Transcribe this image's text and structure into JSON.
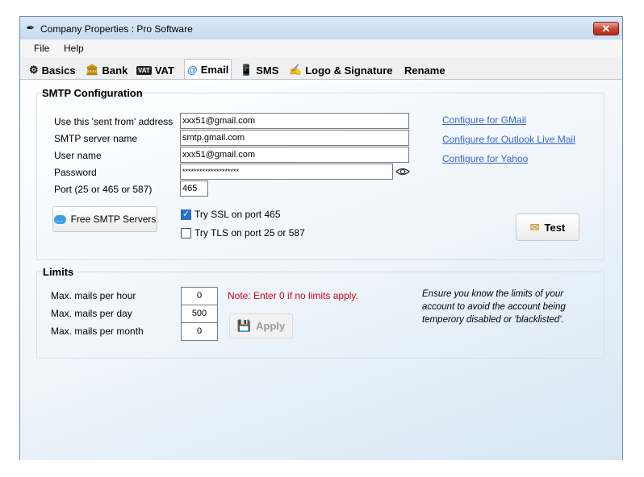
{
  "window": {
    "title": "Company Properties : Pro Software",
    "close_label": "✕"
  },
  "menu": [
    "File",
    "Help"
  ],
  "tabs": [
    {
      "label": "Basics",
      "icon": "gear-icon",
      "glyph": "⚙"
    },
    {
      "label": "Bank",
      "icon": "bank-icon",
      "glyph": "🏛"
    },
    {
      "label": "VAT",
      "icon": "vat-icon",
      "glyph": "VAT"
    },
    {
      "label": "Email",
      "icon": "at-icon",
      "glyph": "@"
    },
    {
      "label": "SMS",
      "icon": "phone-icon",
      "glyph": "📱"
    },
    {
      "label": "Logo & Signature",
      "icon": "signature-icon",
      "glyph": "✍"
    },
    {
      "label": "Rename",
      "icon": "",
      "glyph": ""
    }
  ],
  "smtp": {
    "title": "SMTP Configuration",
    "labels": {
      "sent_from": "Use this 'sent from' address",
      "server": "SMTP server name",
      "username": "User name",
      "password": "Password",
      "port": "Port (25 or 465 or 587)"
    },
    "values": {
      "sent_from": "xxx51@gmail.com",
      "server": "smtp.gmail.com",
      "username": "xxx51@gmail.com",
      "password": "********************",
      "port": "465"
    },
    "links": [
      "Configure for GMail",
      "Configure for Outlook Live Mail",
      "Configure for Yahoo"
    ],
    "free_servers_label": "Free SMTP Servers",
    "ssl_label": "Try SSL on port 465",
    "ssl_checked": true,
    "tls_label": "Try TLS on port 25 or 587",
    "tls_checked": false,
    "test_label": "Test",
    "check_glyph": "✓"
  },
  "limits": {
    "title": "Limits",
    "labels": {
      "hour": "Max. mails per hour",
      "day": "Max. mails per day",
      "month": "Max. mails per month"
    },
    "values": {
      "hour": "0",
      "day": "500",
      "month": "0"
    },
    "note": "Note: Enter 0 if no limits apply.",
    "note_color": "#d0021b",
    "apply_label": "Apply",
    "info": "Ensure you know the limits of your account to avoid the account being temperory disabled or 'blacklisted'."
  },
  "colors": {
    "link": "#3366cc",
    "accent": "#2a6ec7"
  }
}
